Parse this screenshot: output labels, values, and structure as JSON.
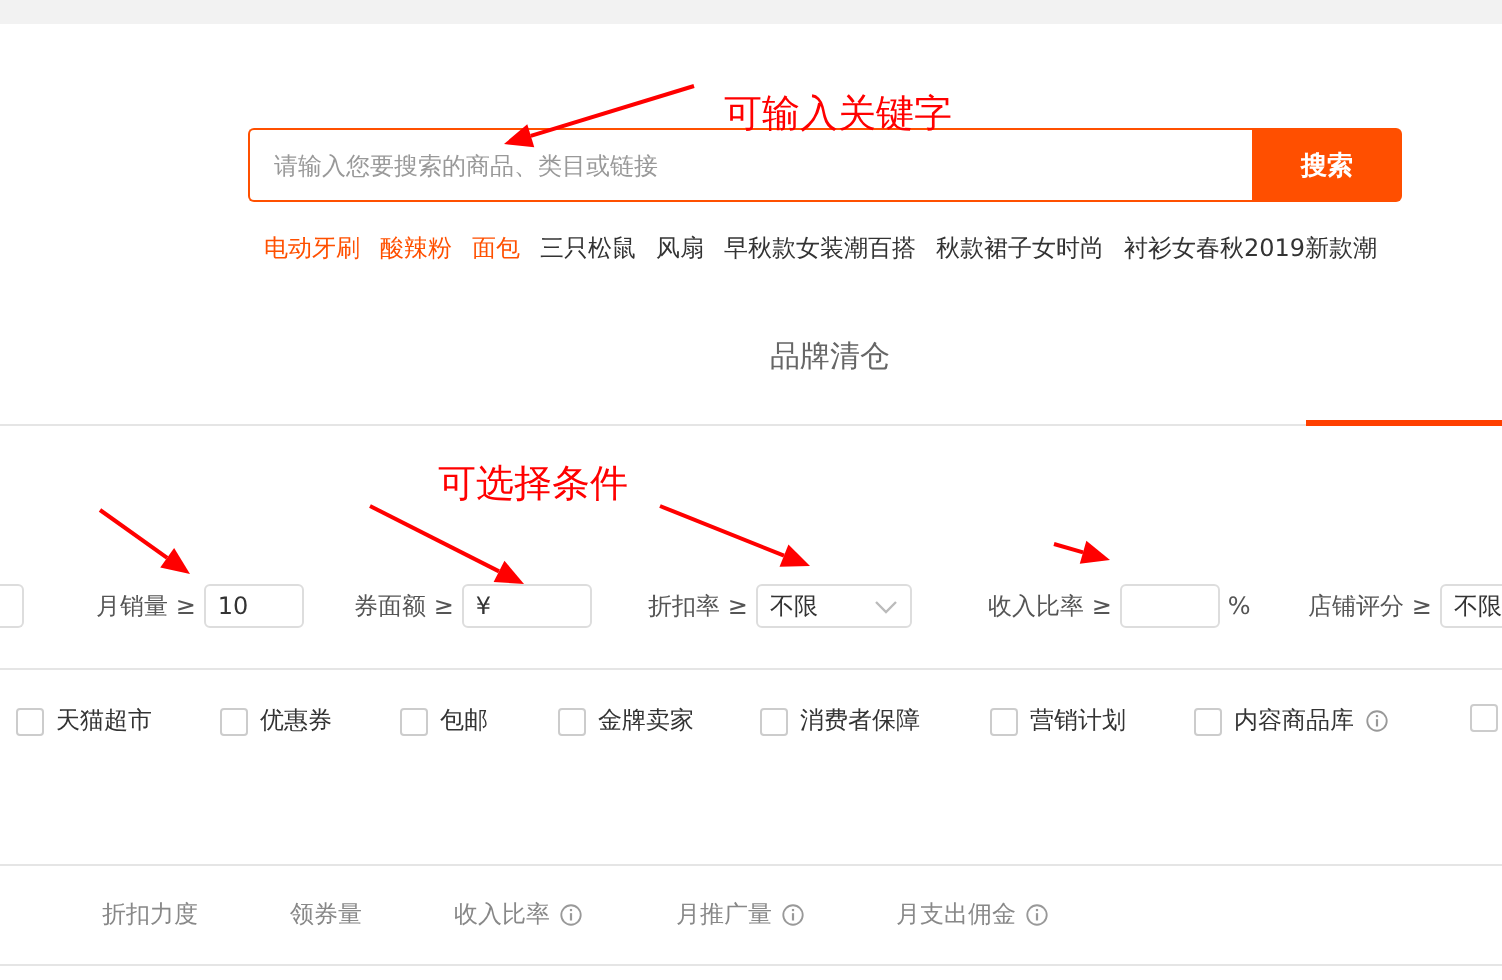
{
  "search": {
    "placeholder": "请输入您要搜索的商品、类目或链接",
    "button": "搜索"
  },
  "hot_words": [
    {
      "label": "电动牙刷",
      "highlighted": true
    },
    {
      "label": "酸辣粉",
      "highlighted": true
    },
    {
      "label": "面包",
      "highlighted": true
    },
    {
      "label": "三只松鼠",
      "highlighted": false
    },
    {
      "label": "风扇",
      "highlighted": false
    },
    {
      "label": "早秋款女装潮百搭",
      "highlighted": false
    },
    {
      "label": "秋款裙子女时尚",
      "highlighted": false
    },
    {
      "label": "衬衫女春秋2019新款潮",
      "highlighted": false
    }
  ],
  "tabs": [
    {
      "label": "品牌清仓",
      "selected": false
    },
    {
      "selected": true
    }
  ],
  "filters": [
    {
      "kind": "stub"
    },
    {
      "kind": "input",
      "label": "月销量",
      "op": "≥",
      "value": "10"
    },
    {
      "kind": "input",
      "label": "券面额",
      "op": "≥",
      "value": "¥"
    },
    {
      "kind": "select",
      "label": "折扣率",
      "op": "≥",
      "value": "不限"
    },
    {
      "kind": "input",
      "label": "收入比率",
      "op": "≥",
      "unit": "%"
    },
    {
      "kind": "select",
      "label": "店铺评分",
      "op": "≥",
      "value": "不限"
    }
  ],
  "options": [
    {
      "label": "天猫超市",
      "checked": false
    },
    {
      "label": "优惠券",
      "checked": false
    },
    {
      "label": "包邮",
      "checked": false
    },
    {
      "label": "金牌卖家",
      "checked": false
    },
    {
      "label": "消费者保障",
      "checked": false
    },
    {
      "label": "营销计划",
      "checked": false
    },
    {
      "label": "内容商品库",
      "checked": false,
      "info": true
    },
    {
      "checked": false
    }
  ],
  "sort_columns": [
    {
      "label": "折扣力度",
      "info": false
    },
    {
      "label": "领券量",
      "info": false
    },
    {
      "label": "收入比率",
      "info": true
    },
    {
      "label": "月推广量",
      "info": true
    },
    {
      "label": "月支出佣金",
      "info": true
    }
  ],
  "annotations": [
    {
      "text": "可输入关键字"
    },
    {
      "text": "可选择条件"
    }
  ]
}
